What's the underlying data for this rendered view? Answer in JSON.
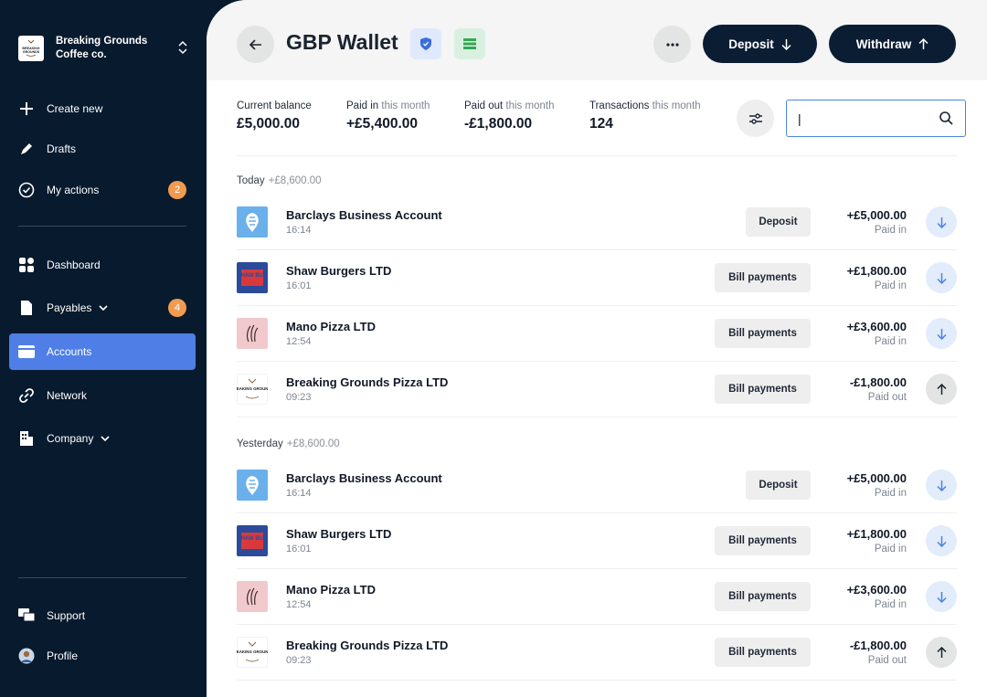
{
  "sidebar": {
    "org_name": "Breaking Grounds Coffee co.",
    "org_logo_text": "BREAKING GROUNDS",
    "items": [
      {
        "label": "Create new",
        "icon": "plus-icon"
      },
      {
        "label": "Drafts",
        "icon": "pencil-icon"
      },
      {
        "label": "My actions",
        "icon": "check-circle-icon",
        "badge": "2"
      },
      {
        "label": "Dashboard",
        "icon": "grid-icon"
      },
      {
        "label": "Payables",
        "icon": "document-icon",
        "badge": "4"
      },
      {
        "label": "Accounts",
        "icon": "card-icon",
        "active": true
      },
      {
        "label": "Network",
        "icon": "link-icon"
      },
      {
        "label": "Company",
        "icon": "building-icon"
      },
      {
        "label": "Support",
        "icon": "chat-icon"
      },
      {
        "label": "Profile",
        "icon": "avatar-icon"
      }
    ]
  },
  "header": {
    "title": "GBP Wallet",
    "deposit_label": "Deposit",
    "withdraw_label": "Withdraw"
  },
  "stats": [
    {
      "label": "Current balance",
      "suffix": "",
      "value": "£5,000.00"
    },
    {
      "label": "Paid in",
      "suffix": "this month",
      "value": "+£5,400.00"
    },
    {
      "label": "Paid out",
      "suffix": "this month",
      "value": "-£1,800.00"
    },
    {
      "label": "Transactions",
      "suffix": "this month",
      "value": "124"
    }
  ],
  "search": {
    "value": "|",
    "placeholder": ""
  },
  "groups": [
    {
      "label": "Today",
      "total": "+£8,600.00",
      "transactions": [
        {
          "name": "Barclays Business Account",
          "time": "16:14",
          "category": "Deposit",
          "amount": "+£5,000.00",
          "status": "Paid in",
          "direction": "in",
          "logo": "barclays"
        },
        {
          "name": "Shaw Burgers LTD",
          "time": "16:01",
          "category": "Bill payments",
          "amount": "+£1,800.00",
          "status": "Paid in",
          "direction": "in",
          "logo": "shaw",
          "logo_text": "SHAW BUR"
        },
        {
          "name": "Mano Pizza LTD",
          "time": "12:54",
          "category": "Bill payments",
          "amount": "+£3,600.00",
          "status": "Paid in",
          "direction": "in",
          "logo": "mano"
        },
        {
          "name": "Breaking Grounds Pizza LTD",
          "time": "09:23",
          "category": "Bill payments",
          "amount": "-£1,800.00",
          "status": "Paid out",
          "direction": "out",
          "logo": "breaking",
          "logo_text": "BREAKING GROUNDS"
        }
      ]
    },
    {
      "label": "Yesterday",
      "total": "+£8,600.00",
      "transactions": [
        {
          "name": "Barclays Business Account",
          "time": "16:14",
          "category": "Deposit",
          "amount": "+£5,000.00",
          "status": "Paid in",
          "direction": "in",
          "logo": "barclays"
        },
        {
          "name": "Shaw Burgers LTD",
          "time": "16:01",
          "category": "Bill payments",
          "amount": "+£1,800.00",
          "status": "Paid in",
          "direction": "in",
          "logo": "shaw",
          "logo_text": "SHAW BUR"
        },
        {
          "name": "Mano Pizza LTD",
          "time": "12:54",
          "category": "Bill payments",
          "amount": "+£3,600.00",
          "status": "Paid in",
          "direction": "in",
          "logo": "mano"
        },
        {
          "name": "Breaking Grounds Pizza LTD",
          "time": "09:23",
          "category": "Bill payments",
          "amount": "-£1,800.00",
          "status": "Paid out",
          "direction": "out",
          "logo": "breaking",
          "logo_text": "BREAKING GROUNDS"
        }
      ]
    }
  ],
  "colors": {
    "sidebar_bg": "#081a2e",
    "accent": "#4f7fe6",
    "badge": "#f29b50",
    "in_arrow": "#4a84e0"
  }
}
